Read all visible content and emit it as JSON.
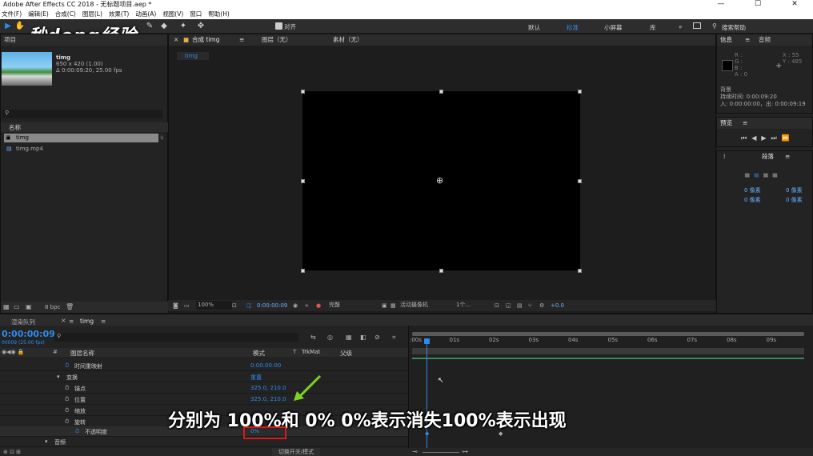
{
  "window": {
    "title": "Adobe After Effects CC 2018 - 无标题项目.aep *"
  },
  "menu": [
    "文件(F)",
    "编辑(E)",
    "合成(C)",
    "图层(L)",
    "效果(T)",
    "动画(A)",
    "视图(V)",
    "窗口",
    "帮助(H)"
  ],
  "toolbar": {
    "align_label": "对齐",
    "workspaces": [
      "默认",
      "标准",
      "小屏幕",
      "库"
    ],
    "search_placeholder": "搜索帮助"
  },
  "watermark": "秒dong经验",
  "project": {
    "title": "项目",
    "item_name": "timg",
    "item_dims": "650 x 420 (1.00)",
    "item_duration": "Δ 0:00:09:20, 25.00 fps",
    "name_header": "名称",
    "files": [
      "timg",
      "timg.mp4"
    ],
    "bpc": "8 bpc"
  },
  "comp_tabs": {
    "comp": "合成 timg",
    "layer": "图层（无）",
    "footage": "素材（无）",
    "subtab": "timg"
  },
  "viewer": {
    "zoom": "100%",
    "timecode": "0:00:00:09",
    "quality": "完整",
    "camera": "活动摄像机",
    "views": "1个...",
    "exposure": "+0.0"
  },
  "info": {
    "title": "信息",
    "audio": "音频",
    "r": "R :",
    "g": "G :",
    "b": "B :",
    "a": "A : 0",
    "x": "X : 55",
    "y": "Y : 485",
    "bg": "背景",
    "duration": "持续时间: 0:00:09:20",
    "inout": "入: 0:00:00:00，出: 0:00:09:19"
  },
  "preview": {
    "title": "预览"
  },
  "paragraph": {
    "title": "段落",
    "px1": "0 像素",
    "px2": "0 像素",
    "px3": "0 像素",
    "px4": "0 像素"
  },
  "timeline": {
    "render_queue": "渲染队列",
    "comp_tab": "timg",
    "timecode": "0:00:00:09",
    "frames": "00009 (25.00 fps)",
    "col_name": "图层名称",
    "col_mode": "模式",
    "col_trkmat": "TrkMat",
    "col_parent": "父级",
    "footer": "切换开关/模式"
  },
  "layers": [
    {
      "label": "时间重映射",
      "value": "0:00:00:00"
    },
    {
      "label": "变换",
      "value": "重置"
    },
    {
      "label": "锚点",
      "value": "325.0, 210.0"
    },
    {
      "label": "位置",
      "value": "325.0, 210.0"
    },
    {
      "label": "缩放",
      "value": ""
    },
    {
      "label": "旋转",
      "value": ""
    },
    {
      "label": "不透明度",
      "value": "0%"
    },
    {
      "label": "音频",
      "value": ""
    }
  ],
  "ruler": [
    ":00s",
    "01s",
    "02s",
    "03s",
    "04s",
    "05s",
    "06s",
    "07s",
    "08s",
    "09s"
  ],
  "caption": "分别为 100%和 0%  0%表示消失100%表示出现"
}
